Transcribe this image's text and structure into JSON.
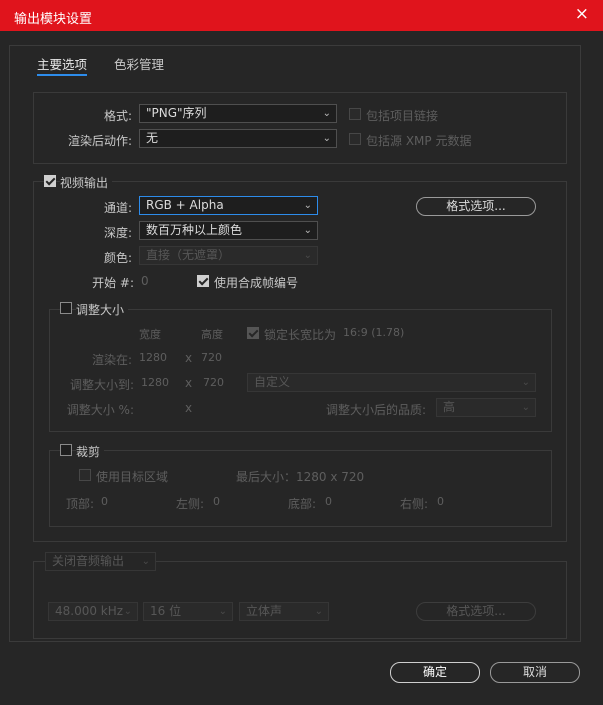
{
  "window": {
    "title": "输出模块设置",
    "close_label": "×"
  },
  "tabs": [
    {
      "label": "主要选项",
      "active": true
    },
    {
      "label": "色彩管理",
      "active": false
    }
  ],
  "format_section": {
    "format_label": "格式:",
    "format_value": "\"PNG\"序列",
    "post_render_label": "渲染后动作:",
    "post_render_value": "无",
    "include_project_link": "包括项目链接",
    "include_xmp": "包括源 XMP 元数据"
  },
  "video": {
    "section_label": "视频输出",
    "checked": true,
    "channel_label": "通道:",
    "channel_value": "RGB + Alpha",
    "depth_label": "深度:",
    "depth_value": "数百万种以上颜色",
    "color_label": "颜色:",
    "color_value": "直接（无遮罩）",
    "start_label": "开始 #:",
    "start_value": "0",
    "use_comp_frame": "使用合成帧编号",
    "format_options_button": "格式选项..."
  },
  "resize": {
    "section_label": "调整大小",
    "width_header": "宽度",
    "height_header": "高度",
    "lock_aspect": "锁定长宽比为",
    "aspect_value": "16:9 (1.78)",
    "render_at_label": "渲染在:",
    "render_w": "1280",
    "render_h": "720",
    "resize_to_label": "调整大小到:",
    "resize_w": "1280",
    "resize_h": "720",
    "x_sep": "x",
    "preset_value": "自定义",
    "percent_label": "调整大小 %:",
    "quality_label": "调整大小后的品质:",
    "quality_value": "高"
  },
  "crop": {
    "section_label": "裁剪",
    "use_roi": "使用目标区域",
    "final_size": "最后大小：1280 x 720",
    "top_label": "顶部:",
    "top_value": "0",
    "left_label": "左侧:",
    "left_value": "0",
    "bottom_label": "底部:",
    "bottom_value": "0",
    "right_label": "右侧:",
    "right_value": "0"
  },
  "audio": {
    "dropdown_value": "关闭音频输出",
    "sample_rate": "48.000 kHz",
    "bit_depth": "16 位",
    "channels": "立体声",
    "format_options_button": "格式选项..."
  },
  "footer": {
    "ok": "确定",
    "cancel": "取消"
  },
  "colors": {
    "titlebar": "#e0141c",
    "accent_blue": "#2d8ceb",
    "panel": "#262626"
  }
}
